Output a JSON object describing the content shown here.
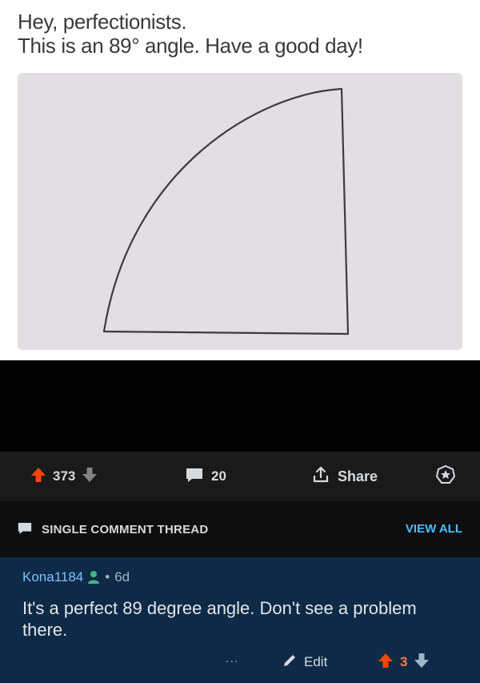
{
  "post": {
    "caption_line1": "Hey, perfectionists.",
    "caption_line2": "This is an 89° angle. Have a good day!"
  },
  "actions": {
    "upvotes": "373",
    "comments": "20",
    "share_label": "Share"
  },
  "thread": {
    "title": "SINGLE COMMENT THREAD",
    "view_all": "VIEW ALL"
  },
  "comment": {
    "author": "Kona1184",
    "age": "6d",
    "body": "It's a perfect 89 degree angle.  Don't see a problem there.",
    "more": "...",
    "edit_label": "Edit",
    "score": "3"
  },
  "colors": {
    "upvote_active": "#ff4500",
    "score_active": "#ff7a45",
    "link_blue": "#4fbcff",
    "comment_bg": "#0e2a47"
  },
  "icons": [
    "upvote-icon",
    "downvote-icon",
    "comment-icon",
    "share-icon",
    "award-icon",
    "user-icon",
    "pencil-icon"
  ]
}
